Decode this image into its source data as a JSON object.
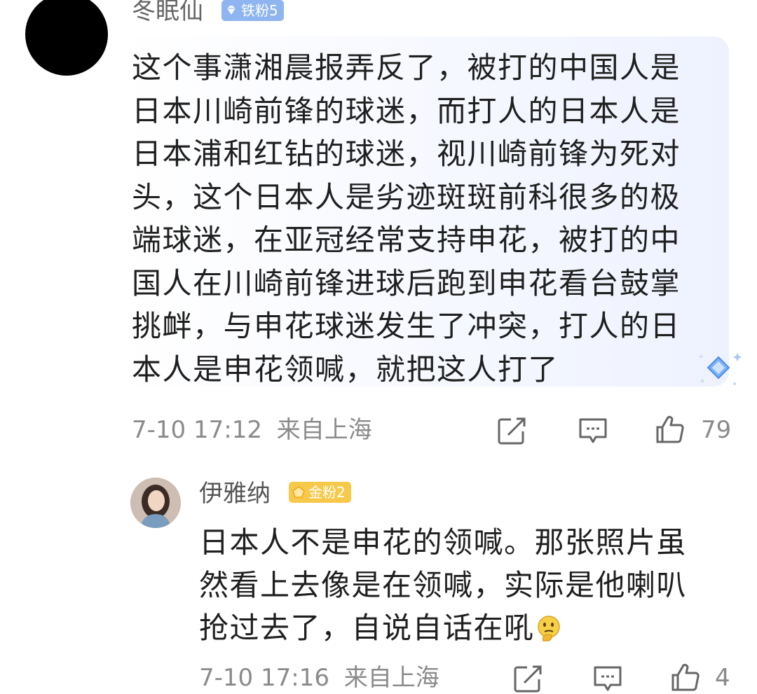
{
  "comments": [
    {
      "username": "冬眠仙",
      "badge": "铁粉5",
      "text": "这个事潇湘晨报弄反了，被打的中国人是日本川崎前锋的球迷，而打人的日本人是日本浦和红钻的球迷，视川崎前锋为死对头，这个日本人是劣迹斑斑前科很多的极端球迷，在亚冠经常支持申花，被打的中国人在川崎前锋进球后跑到申花看台鼓掌挑衅，与申花球迷发生了冲突，打人的日本人是申花领喊，就把这人打了",
      "time": "7-10 17:12",
      "location": "来自上海",
      "likes": "79"
    },
    {
      "username": "伊雅纳",
      "badge": "金粉2",
      "text": "日本人不是申花的领喊。那张照片虽然看上去像是在领喊，实际是他喇叭抢过去了，自说自话在吼",
      "time": "7-10 17:16",
      "location": "来自上海",
      "likes": "4"
    }
  ],
  "colors": {
    "iron_badge": "#8fb5f0",
    "gold_badge": "#f7c94a",
    "meta_gray": "#8a8a8a"
  },
  "icons": [
    "share-icon",
    "comment-icon",
    "like-icon",
    "thinking-emoji",
    "diamond-sparkle-icon"
  ]
}
